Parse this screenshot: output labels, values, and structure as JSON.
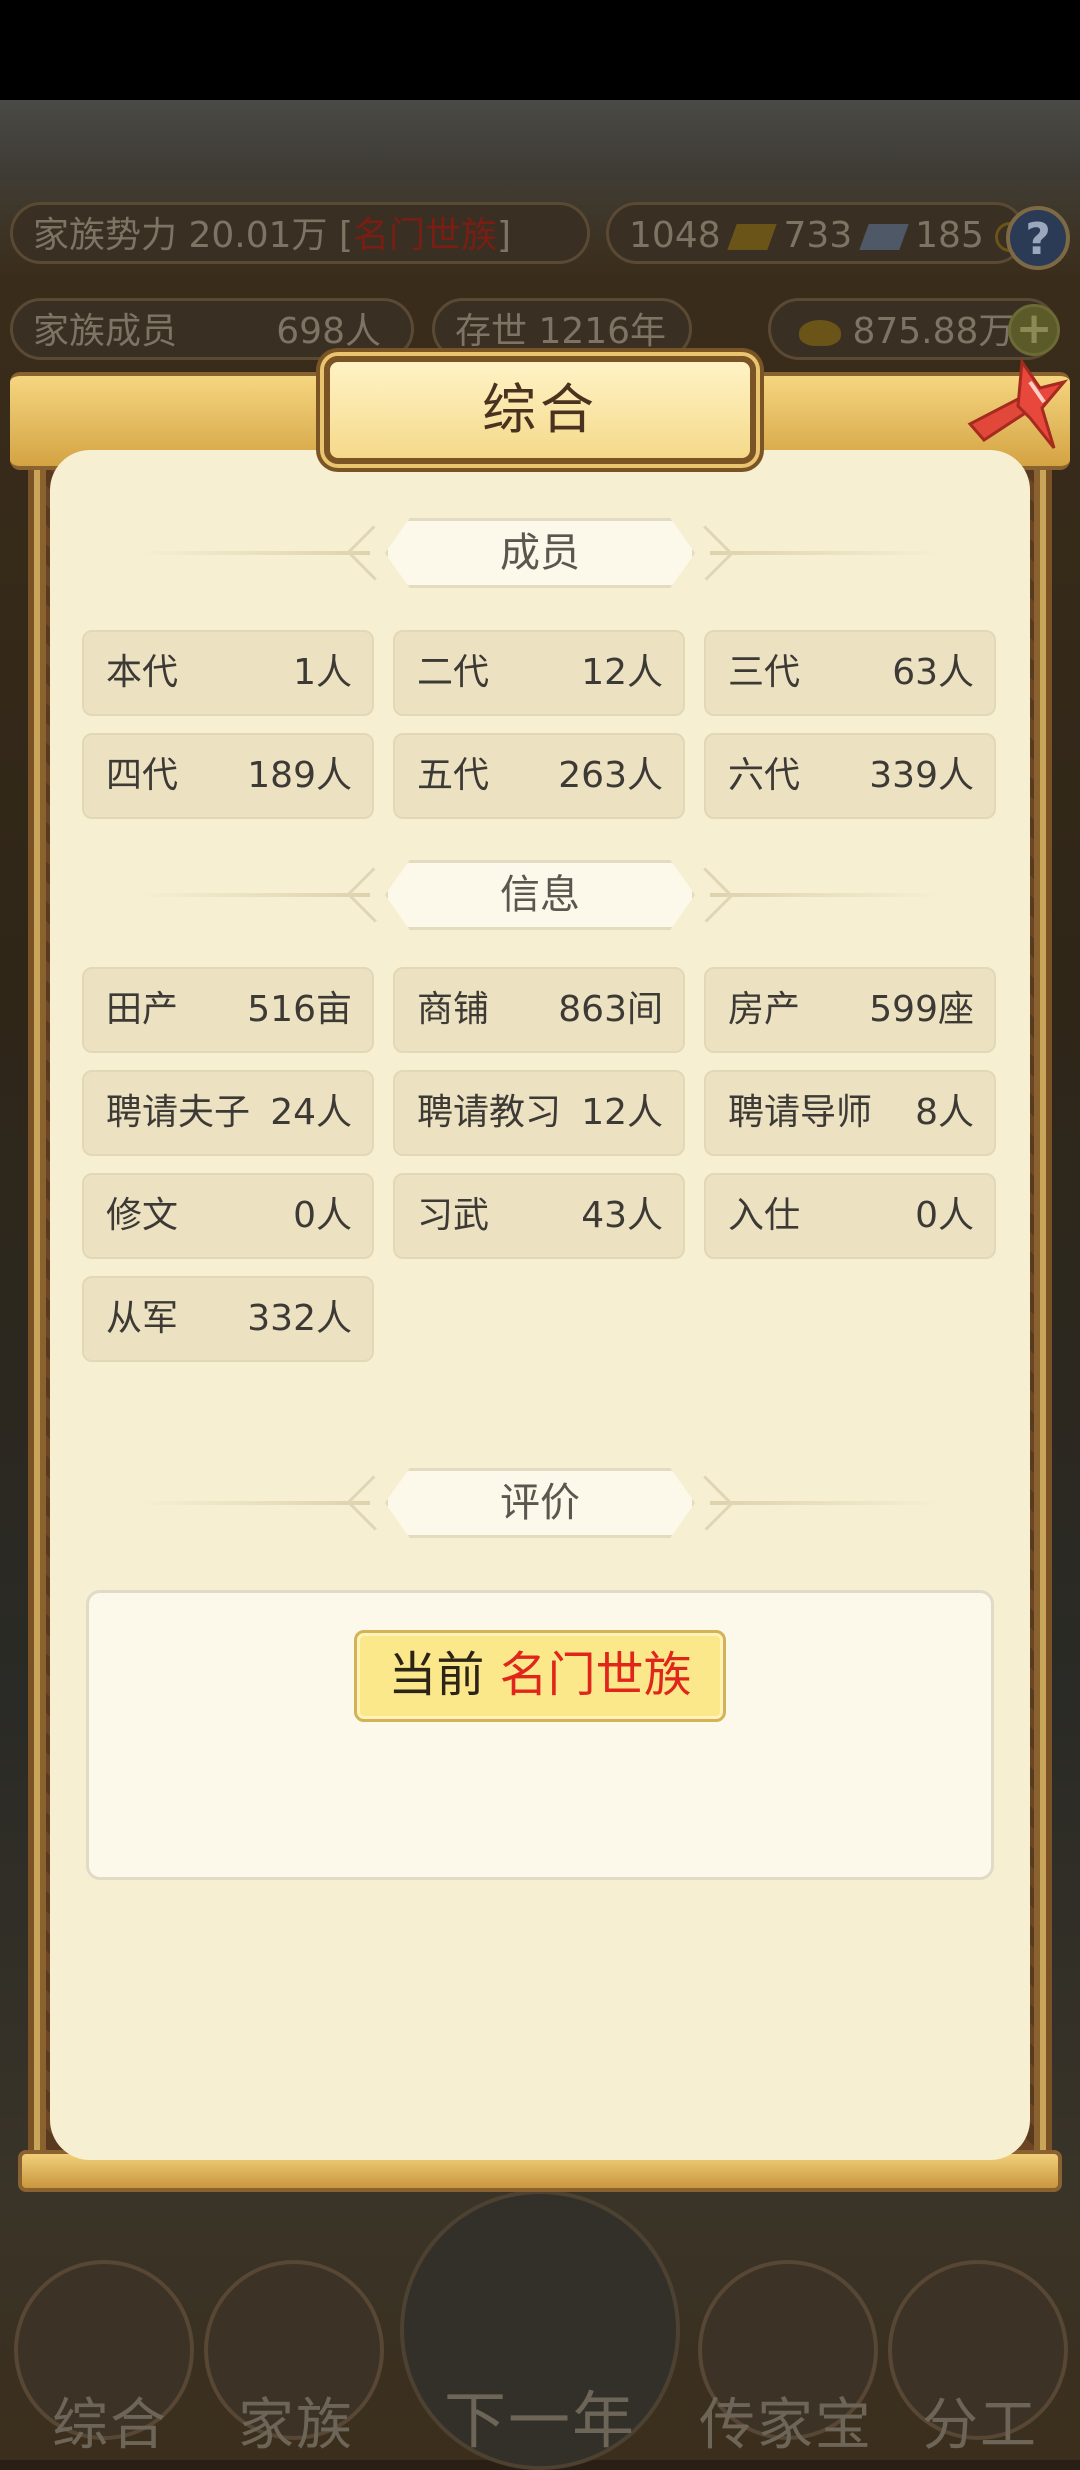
{
  "hud": {
    "power_label": "家族势力 20.01万 [",
    "power_rank": "名门世族",
    "power_close": "]",
    "gold": "1048",
    "silver": "733",
    "coins": "185",
    "members_label": "家族成员",
    "members_value": "698人",
    "existence": "存世 1216年",
    "ingots": "875.88万",
    "help_icon": "question-icon",
    "plus_icon": "plus-icon"
  },
  "modal": {
    "title": "综合",
    "close_icon": "close-icon",
    "sections": {
      "members": "成员",
      "info": "信息",
      "evaluation": "评价"
    },
    "members": [
      {
        "label": "本代",
        "value": "1人"
      },
      {
        "label": "二代",
        "value": "12人"
      },
      {
        "label": "三代",
        "value": "63人"
      },
      {
        "label": "四代",
        "value": "189人"
      },
      {
        "label": "五代",
        "value": "263人"
      },
      {
        "label": "六代",
        "value": "339人"
      }
    ],
    "info": [
      {
        "label": "田产",
        "value": "516亩"
      },
      {
        "label": "商铺",
        "value": "863间"
      },
      {
        "label": "房产",
        "value": "599座"
      },
      {
        "label": "聘请夫子",
        "value": "24人"
      },
      {
        "label": "聘请教习",
        "value": "12人"
      },
      {
        "label": "聘请导师",
        "value": "8人"
      },
      {
        "label": "修文",
        "value": "0人"
      },
      {
        "label": "习武",
        "value": "43人"
      },
      {
        "label": "入仕",
        "value": "0人"
      },
      {
        "label": "从军",
        "value": "332人"
      }
    ],
    "evaluation": {
      "prefix": "当前",
      "rank": "名门世族"
    }
  },
  "bottom_nav": [
    {
      "label": "综合"
    },
    {
      "label": "家族"
    },
    {
      "label": "下一年"
    },
    {
      "label": "传家宝"
    },
    {
      "label": "分工"
    }
  ],
  "colors": {
    "rank_red": "#e0261b",
    "panel_bg": "#f7efd2",
    "cell_bg": "#ece2c2",
    "frame_gold": "#c9a55a"
  }
}
